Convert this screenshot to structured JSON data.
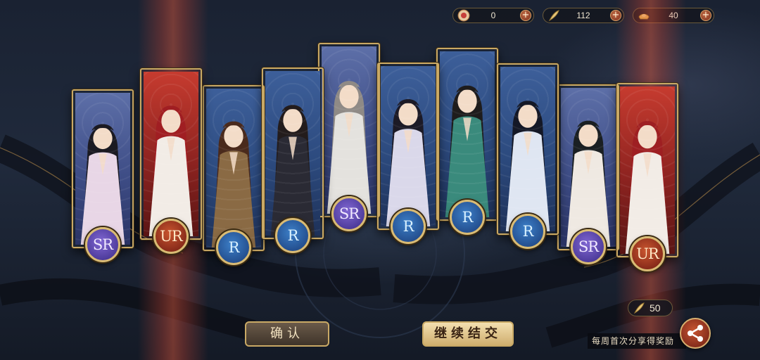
{
  "resources": [
    {
      "icon": "summon-token-icon",
      "value": "0"
    },
    {
      "icon": "feather-icon",
      "value": "112"
    },
    {
      "icon": "gold-ingot-icon",
      "value": "40"
    }
  ],
  "cards": [
    {
      "rarity": "sr",
      "badge": "SR",
      "name": "card-1"
    },
    {
      "rarity": "ur",
      "badge": "UR",
      "name": "card-2"
    },
    {
      "rarity": "r",
      "badge": "R",
      "name": "card-3"
    },
    {
      "rarity": "r",
      "badge": "R",
      "name": "card-4"
    },
    {
      "rarity": "sr",
      "badge": "SR",
      "name": "card-5"
    },
    {
      "rarity": "r",
      "badge": "R",
      "name": "card-6"
    },
    {
      "rarity": "r",
      "badge": "R",
      "name": "card-7"
    },
    {
      "rarity": "r",
      "badge": "R",
      "name": "card-8"
    },
    {
      "rarity": "sr",
      "badge": "SR",
      "name": "card-9"
    },
    {
      "rarity": "ur",
      "badge": "UR",
      "name": "card-10"
    }
  ],
  "buttons": {
    "confirm": "确认",
    "continue": "继续结交"
  },
  "cost": {
    "icon": "feather-icon",
    "value": "50"
  },
  "share": {
    "text": "每周首次分享得奖励",
    "icon": "share-icon"
  },
  "colors": {
    "gold_border": "#c9a965",
    "ur": "#c63b2f",
    "sr": "#5d6fa8",
    "r": "#3d5f9a"
  }
}
